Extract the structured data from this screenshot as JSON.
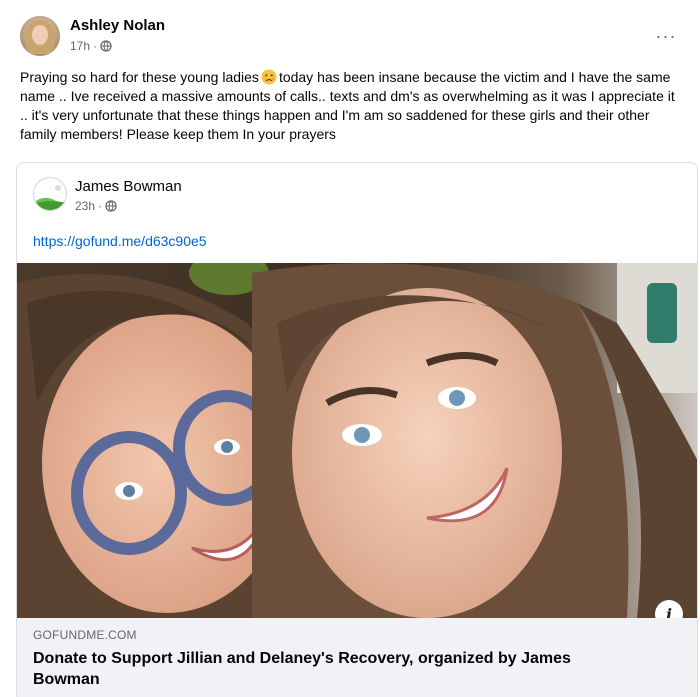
{
  "post": {
    "author": "Ashley Nolan",
    "time": "17h",
    "separator": "·",
    "more": "···",
    "text_before_emoji": "Praying so hard for these young ladies",
    "text_after_emoji": "today has been insane because the victim and I have the same name .. Ive received a massive amounts of calls.. texts and dm's as overwhelming as it was I appreciate it .. it's very unfortunate that these things happen and I'm am so saddened for these girls and their other family members! Please keep them In your prayers",
    "emoji": "sad-tear-emoji-icon"
  },
  "shared": {
    "author": "James Bowman",
    "time": "23h",
    "separator": "·",
    "link": "https://gofund.me/d63c90e5",
    "photo_icon": "two-smiling-girls-photo",
    "info": "i",
    "domain": "GOFUNDME.COM",
    "title": "Donate to Support Jillian and Delaney's Recovery, organized by James Bowman"
  },
  "colors": {
    "link": "#0064d1",
    "meta": "#65676b",
    "footer_bg": "#f0f2f5",
    "border": "#dadde1"
  }
}
